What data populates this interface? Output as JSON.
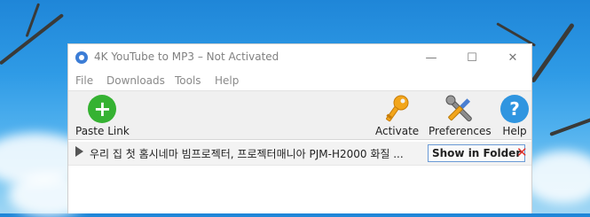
{
  "window": {
    "title": "4K YouTube to MP3 – Not Activated",
    "controls": {
      "minimize": "—",
      "maximize": "☐",
      "close": "✕"
    }
  },
  "menu": [
    "File",
    "Downloads",
    "Tools",
    "Help"
  ],
  "toolbar": {
    "paste_link": "Paste Link",
    "activate": "Activate",
    "preferences": "Preferences",
    "help": "Help"
  },
  "downloads": [
    {
      "title": "우리 집 첫 홈시네마 빔프로젝터, 프로젝터매니아 PJM-H2000 화질 ...",
      "action": "Show in Folder",
      "remove": "✕"
    }
  ],
  "colors": {
    "paste_green": "#35b232",
    "help_blue": "#2f95e0",
    "key_gold": "#f2a51a",
    "remove_red": "#e0302a"
  },
  "icons": [
    "app-logo-icon",
    "plus-icon",
    "key-icon",
    "wrench-screwdriver-icon",
    "question-icon",
    "play-icon",
    "close-icon"
  ]
}
